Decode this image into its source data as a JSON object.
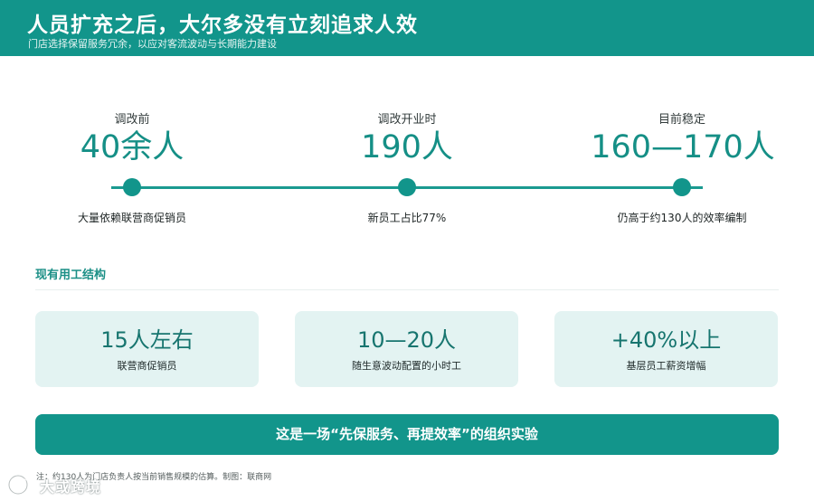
{
  "header": {
    "title": "人员扩充之后，大尔多没有立刻追求人效",
    "subtitle": "门店选择保留服务冗余，以应对客流波动与长期能力建设"
  },
  "timeline": [
    {
      "label": "调改前",
      "value": "40余人",
      "desc": "大量依赖联营商促销员"
    },
    {
      "label": "调改开业时",
      "value": "190人",
      "desc": "新员工占比77%"
    },
    {
      "label": "目前稳定",
      "value": "160—170人",
      "desc": "仍高于约130人的效率编制"
    }
  ],
  "structure": {
    "title": "现有用工结构",
    "cards": [
      {
        "value": "15人左右",
        "label": "联营商促销员"
      },
      {
        "value": "10—20人",
        "label": "随生意波动配置的小时工"
      },
      {
        "value": "+40%以上",
        "label": "基层员工薪资增幅"
      }
    ]
  },
  "banner": "这是一场“先保服务、再提效率”的组织实验",
  "footnote": "注：约130人为门店负责人按当前销售规模的估算。制图：联商网",
  "watermark": "大或跨境",
  "colors": {
    "accent": "#12958b",
    "card_bg": "#e3f3f2"
  }
}
